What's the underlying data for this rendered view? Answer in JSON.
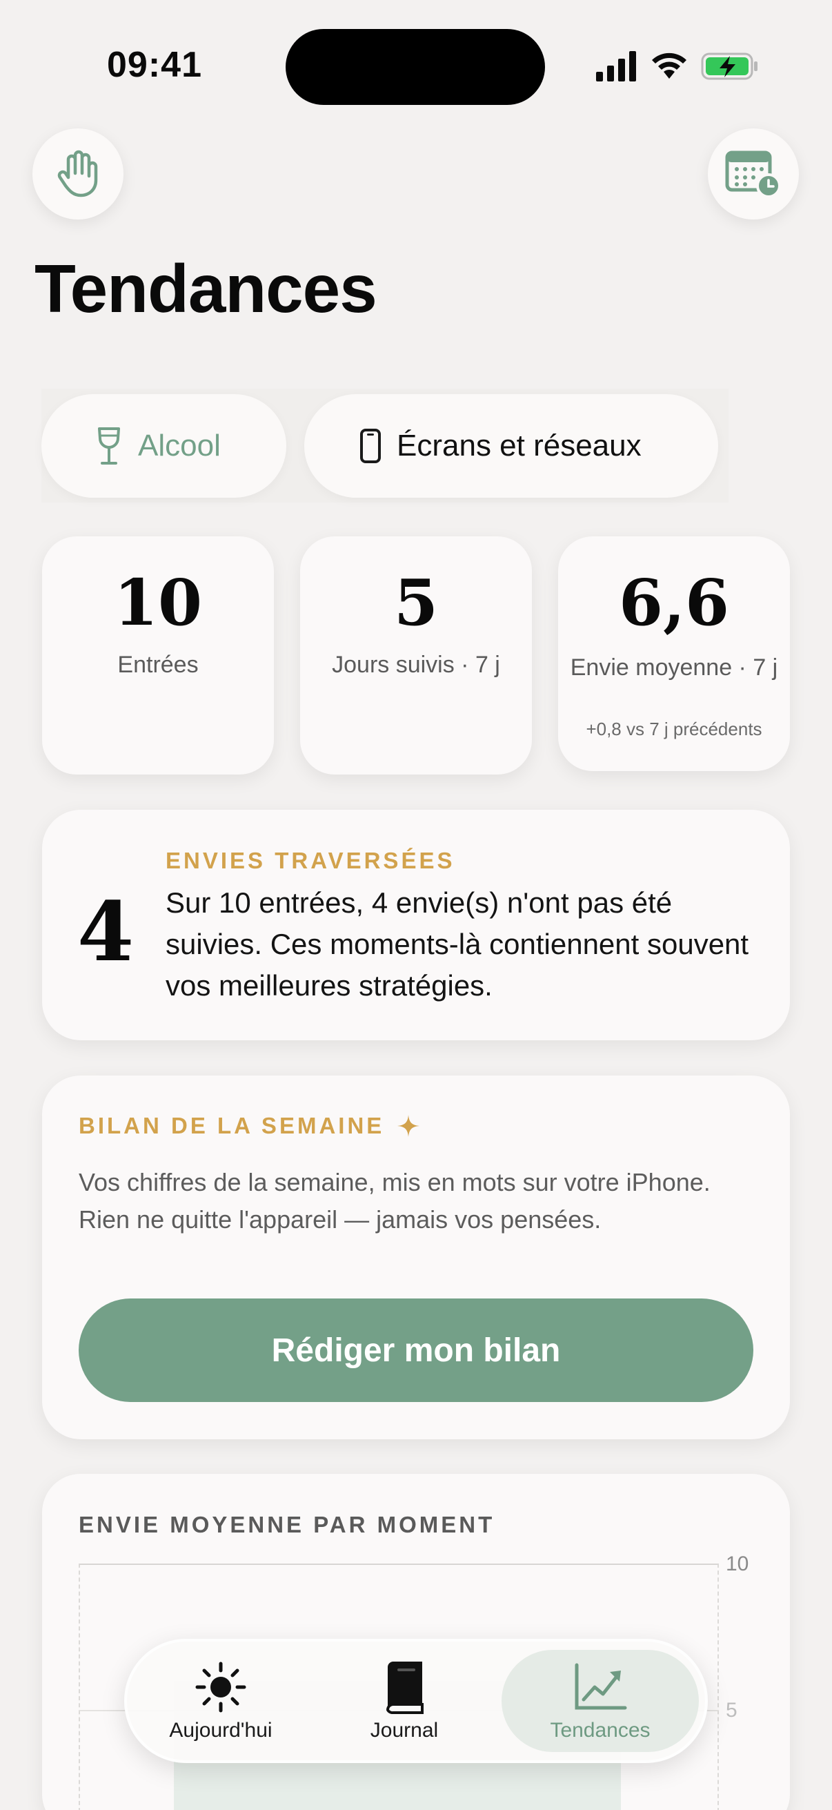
{
  "status_bar": {
    "time": "09:41"
  },
  "header": {
    "left_icon": "hand-icon",
    "right_icon": "calendar-clock-icon",
    "title": "Tendances"
  },
  "categories": [
    {
      "label": "Alcool",
      "icon": "wine-glass-icon",
      "selected": true
    },
    {
      "label": "Écrans et réseaux",
      "icon": "phone-icon",
      "selected": false
    }
  ],
  "stats": [
    {
      "value": "10",
      "label": "Entrées"
    },
    {
      "value": "5",
      "label": "Jours suivis · 7 j"
    },
    {
      "value": "6,6",
      "label": "Envie moyenne · 7 j",
      "note": "+0,8 vs 7 j précédents"
    }
  ],
  "envies": {
    "count": "4",
    "eyebrow": "ENVIES TRAVERSÉES",
    "text": "Sur 10 entrées, 4 envie(s) n'ont pas été suivies. Ces moments-là contiennent souvent vos meilleures stratégies."
  },
  "bilan": {
    "eyebrow": "BILAN DE LA SEMAINE",
    "text": "Vos chiffres de la semaine, mis en mots sur votre iPhone. Rien ne quitte l'appareil — jamais vos pensées.",
    "button": "Rédiger mon bilan"
  },
  "chart": {
    "title": "ENVIE MOYENNE PAR MOMENT",
    "y_ticks": [
      "10",
      "5"
    ]
  },
  "chart_data": {
    "type": "bar",
    "title": "ENVIE MOYENNE PAR MOMENT",
    "ylim": [
      0,
      10
    ],
    "y_ticks": [
      10,
      5
    ],
    "categories": [],
    "values": []
  },
  "tabbar": {
    "items": [
      {
        "label": "Aujourd'hui",
        "icon": "sun-icon"
      },
      {
        "label": "Journal",
        "icon": "book-icon"
      },
      {
        "label": "Tendances",
        "icon": "trend-chart-icon",
        "active": true
      }
    ]
  },
  "colors": {
    "accent_green": "#74a088",
    "eyebrow_gold": "#d2a24c",
    "background": "#f3f1f0",
    "card": "#fbf9f9"
  }
}
